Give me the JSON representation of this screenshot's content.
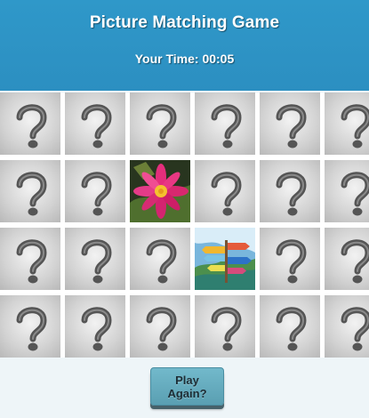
{
  "game": {
    "title": "Picture Matching Game",
    "timer_text": "Your Time: 00:05",
    "play_again_label": "Play Again?"
  },
  "board": {
    "rows": 4,
    "columns": 6,
    "hidden_card_icon": "question-mark-icon",
    "revealed_cards": [
      {
        "row": 2,
        "column": 3,
        "image": "pink-flower-image"
      },
      {
        "row": 3,
        "column": 4,
        "image": "signpost-image"
      }
    ]
  },
  "colors": {
    "header": "#2f98c9",
    "button": "#63a9bb",
    "card_back": "#d3d3d3"
  }
}
